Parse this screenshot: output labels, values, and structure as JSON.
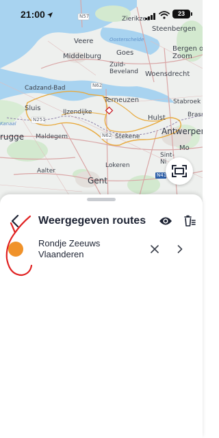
{
  "status_bar": {
    "time": "21:00",
    "battery": "23"
  },
  "map": {
    "places": {
      "zierikzee": "Zierikzee",
      "steenbergen": "Steenbergen",
      "veere": "Veere",
      "goes": "Goes",
      "bergen_op_zoom": "Bergen op\nZoom",
      "middelburg": "Middelburg",
      "zuid_beveland": "Zuid-\nBeveland",
      "oosterschelde": "Oosterschelde",
      "woensdrecht": "Woensdrecht",
      "cadzand_bad": "Cadzand-Bad",
      "terneuzen": "Terneuzen",
      "stabroek": "Stabroek",
      "sluis": "Sluis",
      "ijzendijke": "IJzendijke",
      "hulst": "Hulst",
      "brasschaat": "Brass",
      "kanaal": "Kanaal",
      "brugge": "rugge",
      "maldegem": "Maldegem",
      "stekene": "Stekene",
      "antwerpen": "Antwerpen",
      "aalter": "Aalter",
      "lokeren": "Lokeren",
      "sint_niklaas": "Sint-\nNi",
      "gent": "Gent",
      "mo": "Mo"
    },
    "road_labels": {
      "n57": "N57",
      "n62_top": "N62",
      "n62_mid": "N62",
      "n251": "N251",
      "n41": "N41"
    }
  },
  "map_controls": {
    "fit_icon": "fit-to-screen-icon"
  },
  "sheet": {
    "title": "Weergegeven routes",
    "routes": [
      {
        "name": "Rondje Zeeuws Vlaanderen",
        "color": "#f0922a"
      }
    ]
  },
  "colors": {
    "accent": "#1d2333",
    "route": "#e8a93c",
    "water": "#a8d3f0",
    "annotation": "#e02020"
  }
}
